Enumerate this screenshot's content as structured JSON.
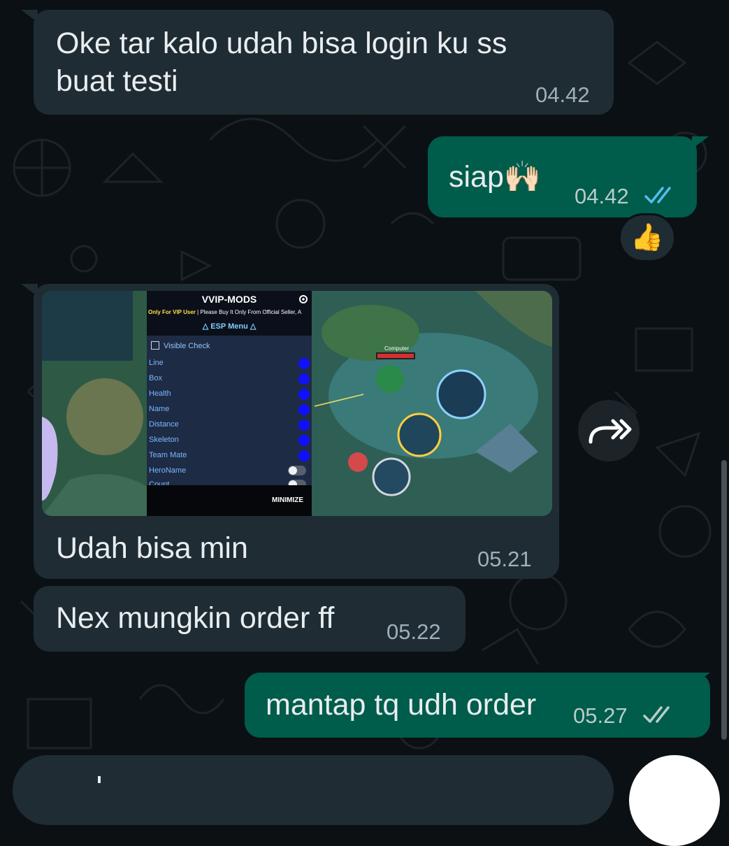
{
  "messages": [
    {
      "direction": "incoming",
      "text_line1": "Oke tar kalo udah bisa login ku ss",
      "text_line2": "buat testi",
      "time": "04.42"
    },
    {
      "direction": "outgoing",
      "text": "siap🙌🏻",
      "time": "04.42",
      "status": "read"
    },
    {
      "direction": "incoming",
      "caption": "Udah bisa min",
      "time": "05.21"
    },
    {
      "direction": "incoming",
      "text": "Nex mungkin order ff",
      "time": "05.22"
    },
    {
      "direction": "outgoing",
      "text": "mantap tq udh order",
      "time": "05.27",
      "status": "delivered"
    }
  ],
  "reaction": {
    "emoji": "👍"
  },
  "forward_icon": "forward-icon",
  "media_image": {
    "menu_title": "VVIP-MODS",
    "menu_notice_highlight": "Only For VIP User",
    "menu_notice_rest": "| Please Buy It Only From Official Seller, A",
    "menu_section": "△ ESP Menu △",
    "visible_check": "Visible Check",
    "items": [
      "Line",
      "Box",
      "Health",
      "Name",
      "Distance",
      "Skeleton",
      "Team Mate",
      "HeroName",
      "Count"
    ],
    "minimize": "MINIMIZE",
    "hero_label": "Computer"
  },
  "colors": {
    "background": "#0b1014",
    "incoming_bubble": "#1f2c34",
    "outgoing_bubble": "#005c4b",
    "read_ticks": "#53bdeb",
    "delivered_ticks": "#b7cdc7"
  }
}
